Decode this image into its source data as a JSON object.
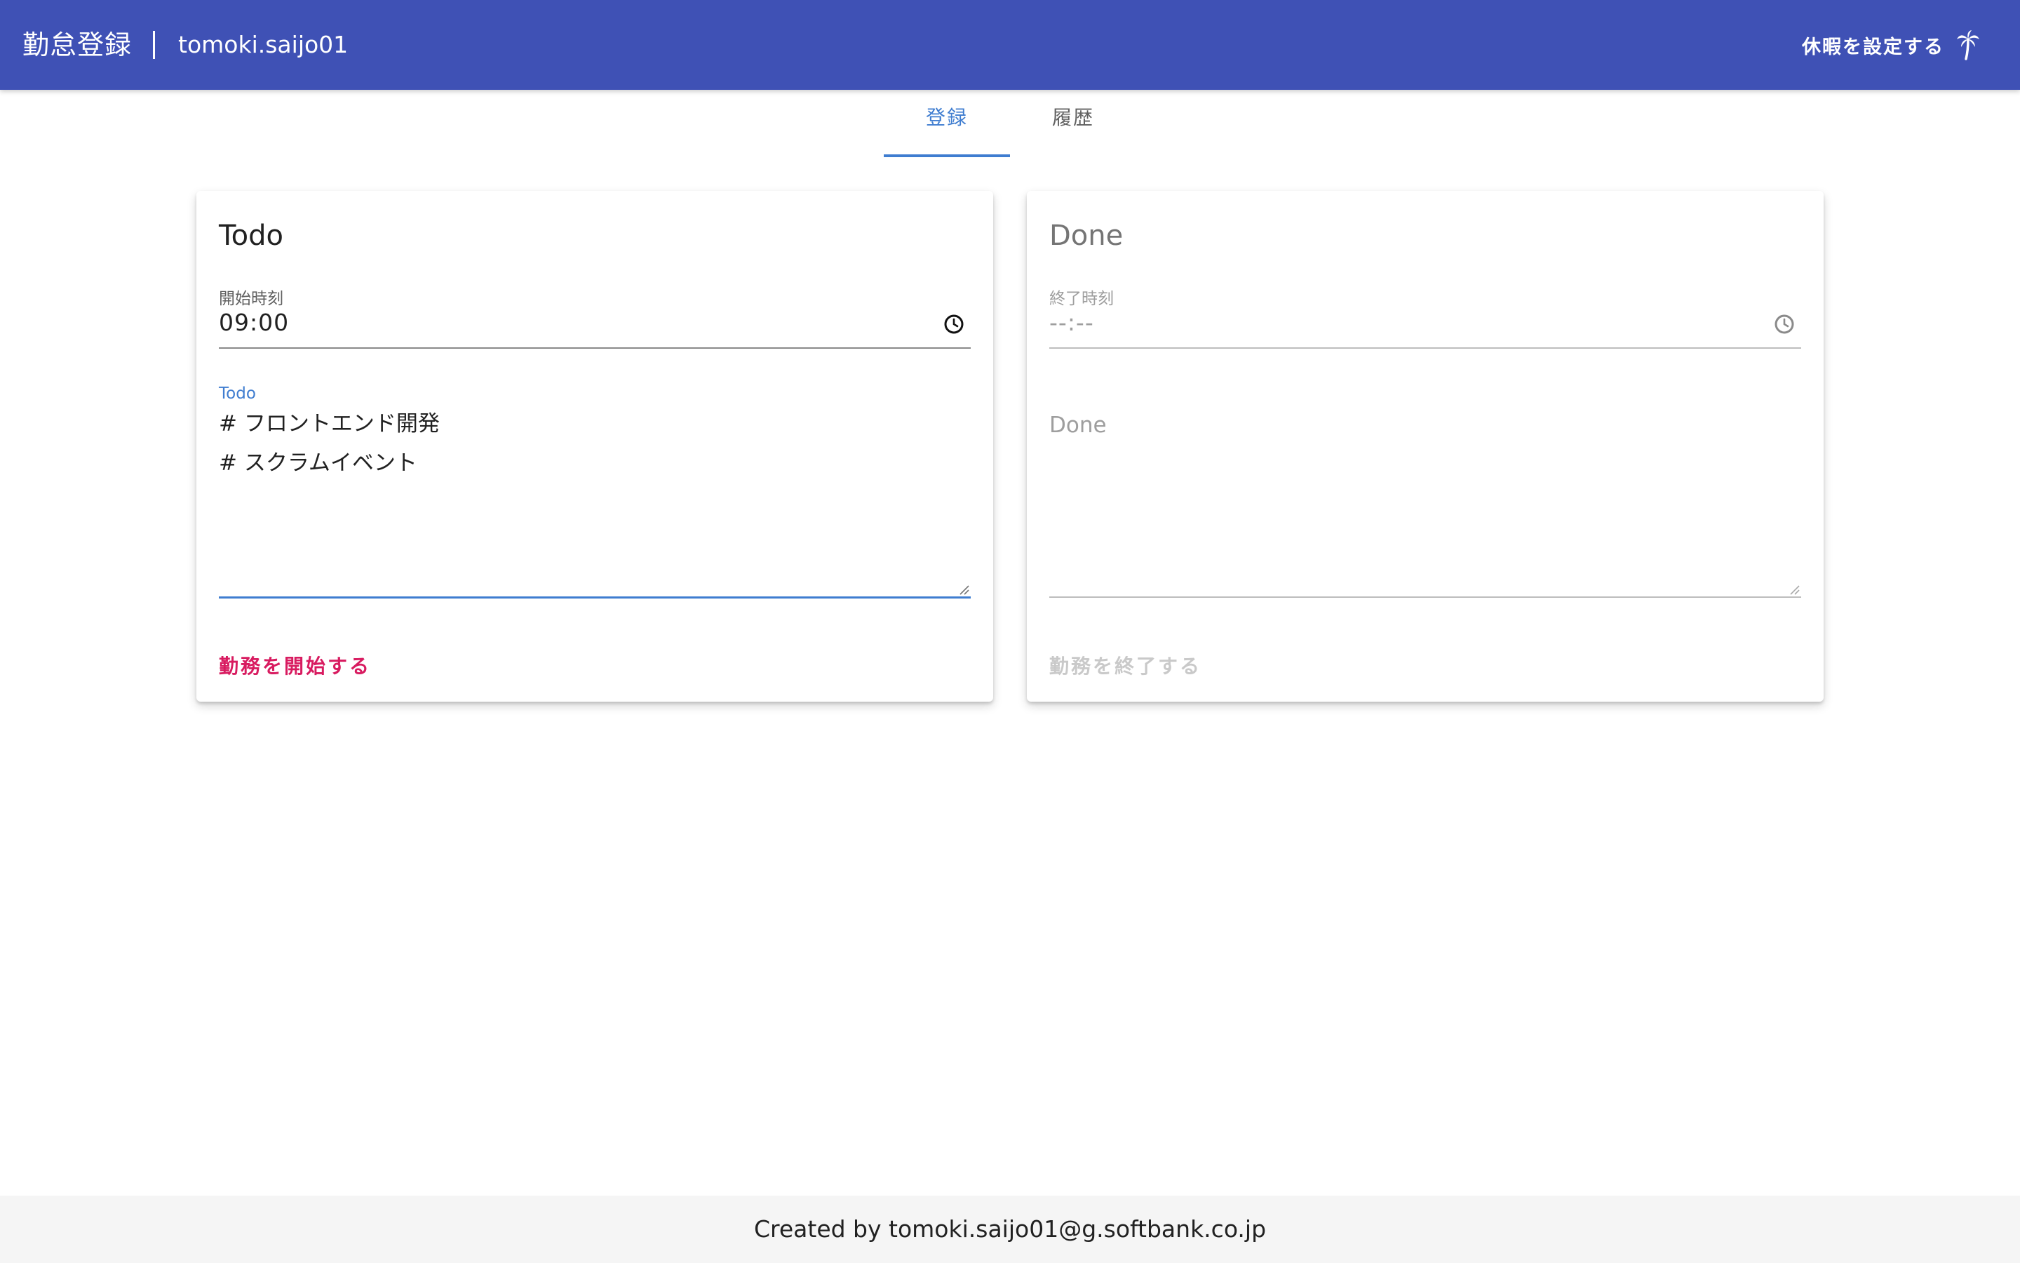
{
  "header": {
    "title": "勤怠登録",
    "user": "tomoki.saijo01",
    "vacation_button": "休暇を設定する",
    "vacation_icon": "palm-tree-icon",
    "background_color": "#3f51b5"
  },
  "tabs": [
    {
      "label": "登録",
      "active": true
    },
    {
      "label": "履歴",
      "active": false
    }
  ],
  "todo_card": {
    "title": "Todo",
    "time_label": "開始時刻",
    "time_value": "09:00",
    "textarea_label": "Todo",
    "textarea_value": "# フロントエンド開発\n# スクラムイベント",
    "button": "勤務を開始する",
    "button_color": "#d81b60"
  },
  "done_card": {
    "title": "Done",
    "time_label": "終了時刻",
    "time_value": "--:--",
    "textarea_placeholder": "Done",
    "button": "勤務を終了する"
  },
  "footer": {
    "text": "Created by tomoki.saijo01@g.softbank.co.jp"
  }
}
